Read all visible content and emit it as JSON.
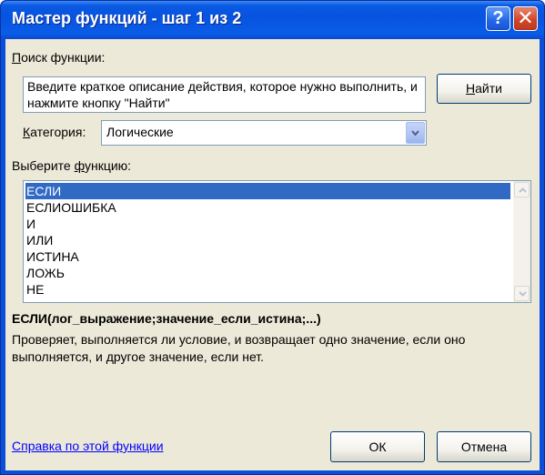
{
  "window": {
    "title": "Мастер функций - шаг 1 из 2",
    "help_button": "?",
    "close_button": "✕"
  },
  "search": {
    "label_prefix": "П",
    "label_rest": "оиск функции:",
    "text": "Введите краткое описание действия, которое нужно выполнить, и нажмите кнопку \"Найти\"",
    "find_button_prefix": "Н",
    "find_button_rest": "айти"
  },
  "category": {
    "label_prefix": "К",
    "label_rest": "атегория:",
    "value": "Логические"
  },
  "functions": {
    "label_prefix": "Выберите ",
    "label_accel": "ф",
    "label_rest": "ункцию:",
    "items": [
      "ЕСЛИ",
      "ЕСЛИОШИБКА",
      "И",
      "ИЛИ",
      "ИСТИНА",
      "ЛОЖЬ",
      "НЕ"
    ],
    "selected_index": 0
  },
  "selected_function": {
    "signature": "ЕСЛИ(лог_выражение;значение_если_истина;...)",
    "description": "Проверяет, выполняется ли условие, и возвращает одно значение, если оно выполняется, и другое значение, если нет."
  },
  "footer": {
    "help_link": "Справка по этой функции",
    "ok_button": "ОК",
    "cancel_button": "Отмена"
  },
  "colors": {
    "titlebar": "#0753e0",
    "dialog_bg": "#ece9d8",
    "selection": "#316ac5",
    "link": "#0000ff"
  }
}
